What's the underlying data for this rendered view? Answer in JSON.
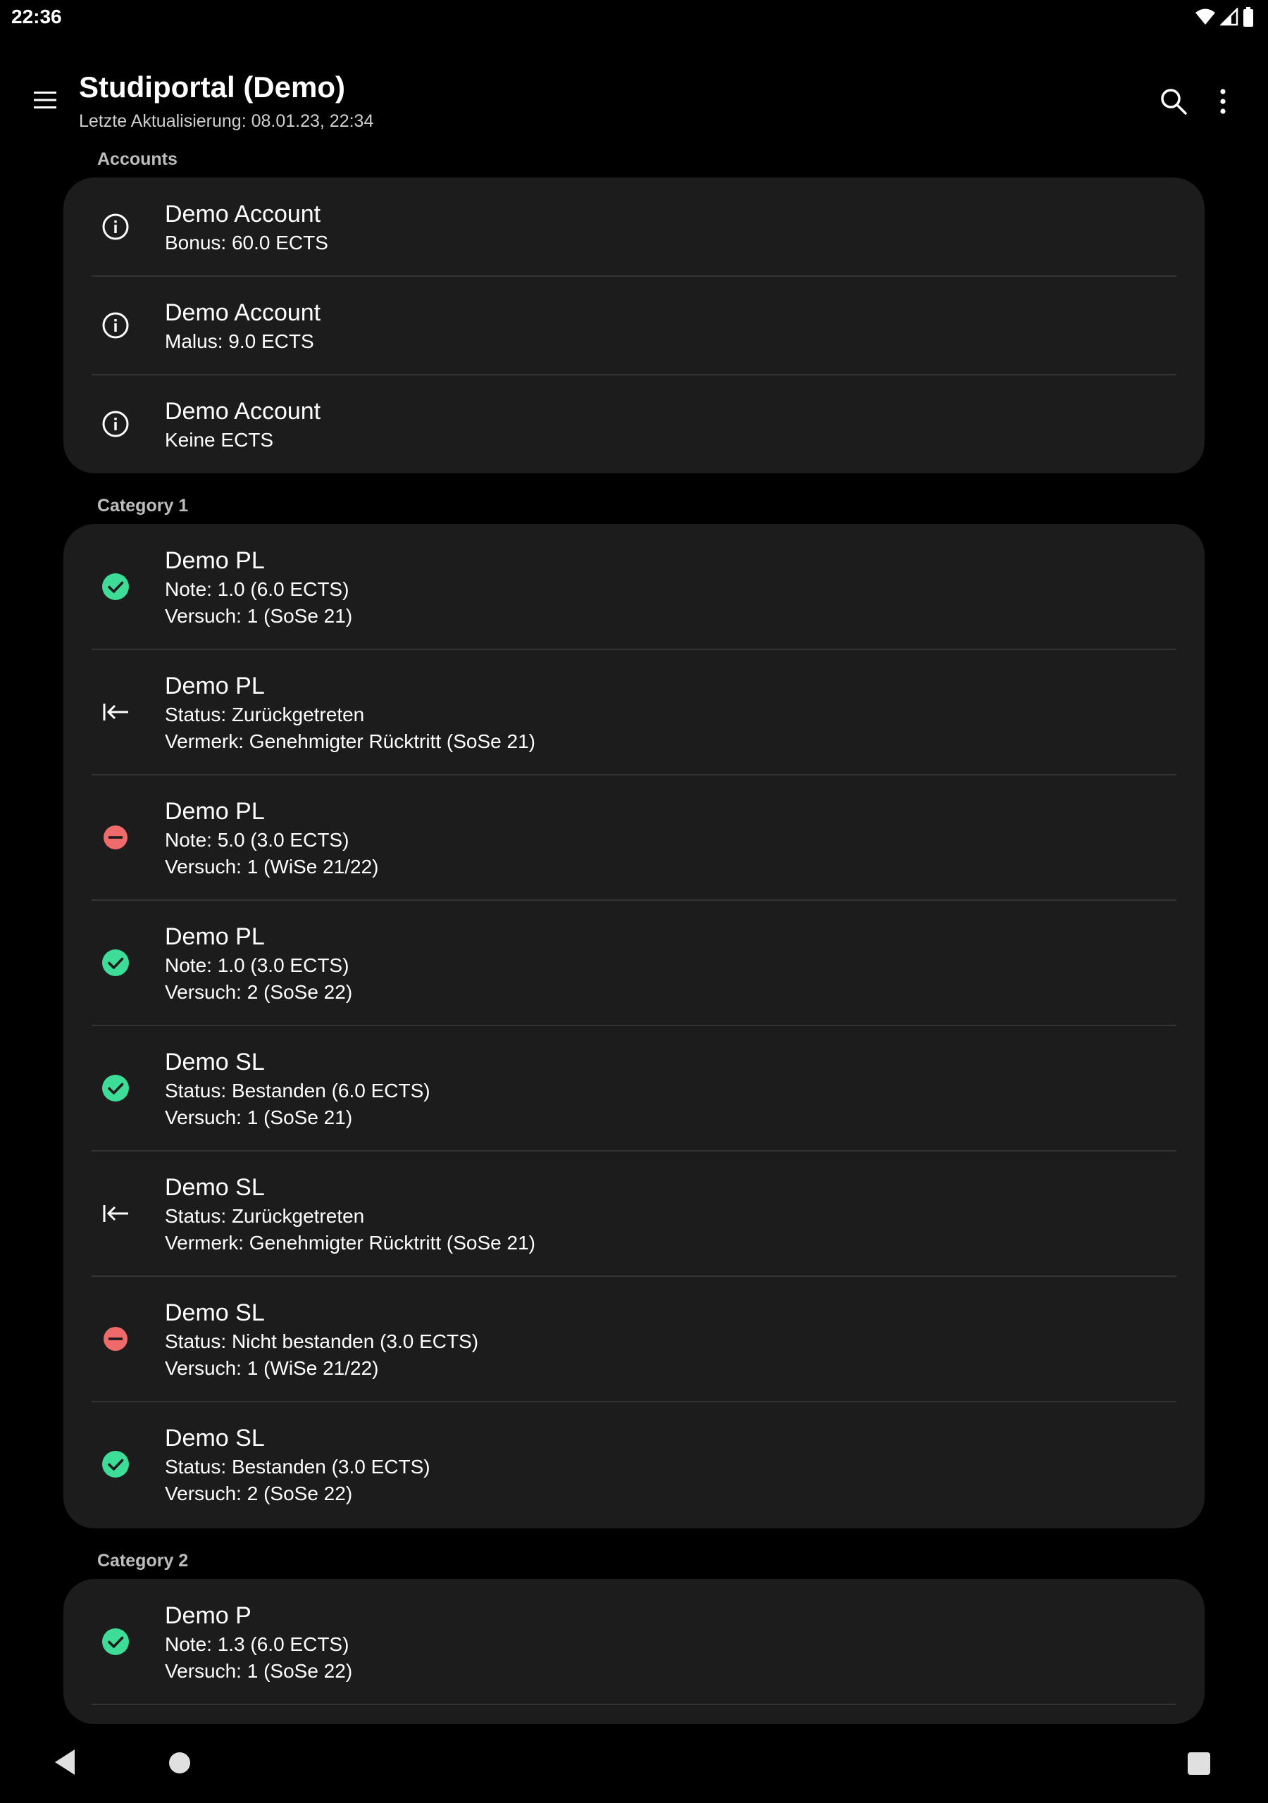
{
  "status_bar": {
    "time": "22:36"
  },
  "app_bar": {
    "title": "Studiportal (Demo)",
    "subtitle": "Letzte Aktualisierung: 08.01.23, 22:34"
  },
  "sections": [
    {
      "header": "Accounts",
      "items": [
        {
          "icon": "info-icon",
          "title": "Demo Account",
          "lines": [
            "Bonus: 60.0 ECTS"
          ]
        },
        {
          "icon": "info-icon",
          "title": "Demo Account",
          "lines": [
            "Malus: 9.0 ECTS"
          ]
        },
        {
          "icon": "info-icon",
          "title": "Demo Account",
          "lines": [
            "Keine ECTS"
          ]
        }
      ]
    },
    {
      "header": "Category 1",
      "items": [
        {
          "icon": "passed-check-icon",
          "title": "Demo PL",
          "lines": [
            "Note: 1.0 (6.0 ECTS)",
            "Versuch: 1 (SoSe 21)"
          ]
        },
        {
          "icon": "withdrawn-icon",
          "title": "Demo PL",
          "lines": [
            "Status: Zurückgetreten",
            "Vermerk: Genehmigter Rücktritt (SoSe 21)"
          ]
        },
        {
          "icon": "failed-minus-icon",
          "title": "Demo PL",
          "lines": [
            "Note: 5.0 (3.0 ECTS)",
            "Versuch: 1 (WiSe 21/22)"
          ]
        },
        {
          "icon": "passed-check-icon",
          "title": "Demo PL",
          "lines": [
            "Note: 1.0 (3.0 ECTS)",
            "Versuch: 2 (SoSe 22)"
          ]
        },
        {
          "icon": "passed-check-icon",
          "title": "Demo SL",
          "lines": [
            "Status: Bestanden (6.0 ECTS)",
            "Versuch: 1 (SoSe 21)"
          ]
        },
        {
          "icon": "withdrawn-icon",
          "title": "Demo SL",
          "lines": [
            "Status: Zurückgetreten",
            "Vermerk: Genehmigter Rücktritt (SoSe 21)"
          ]
        },
        {
          "icon": "failed-minus-icon",
          "title": "Demo SL",
          "lines": [
            "Status: Nicht bestanden (3.0 ECTS)",
            "Versuch: 1 (WiSe 21/22)"
          ]
        },
        {
          "icon": "passed-check-icon",
          "title": "Demo SL",
          "lines": [
            "Status: Bestanden (3.0 ECTS)",
            "Versuch: 2 (SoSe 22)"
          ]
        }
      ]
    },
    {
      "header": "Category 2",
      "items": [
        {
          "icon": "passed-check-icon",
          "title": "Demo P",
          "lines": [
            "Note: 1.3 (6.0 ECTS)",
            "Versuch: 1 (SoSe 22)"
          ]
        }
      ]
    }
  ],
  "colors": {
    "passed": "#3ddc97",
    "failed": "#ef6b6b",
    "card": "#1c1c1c",
    "background": "#000000"
  }
}
